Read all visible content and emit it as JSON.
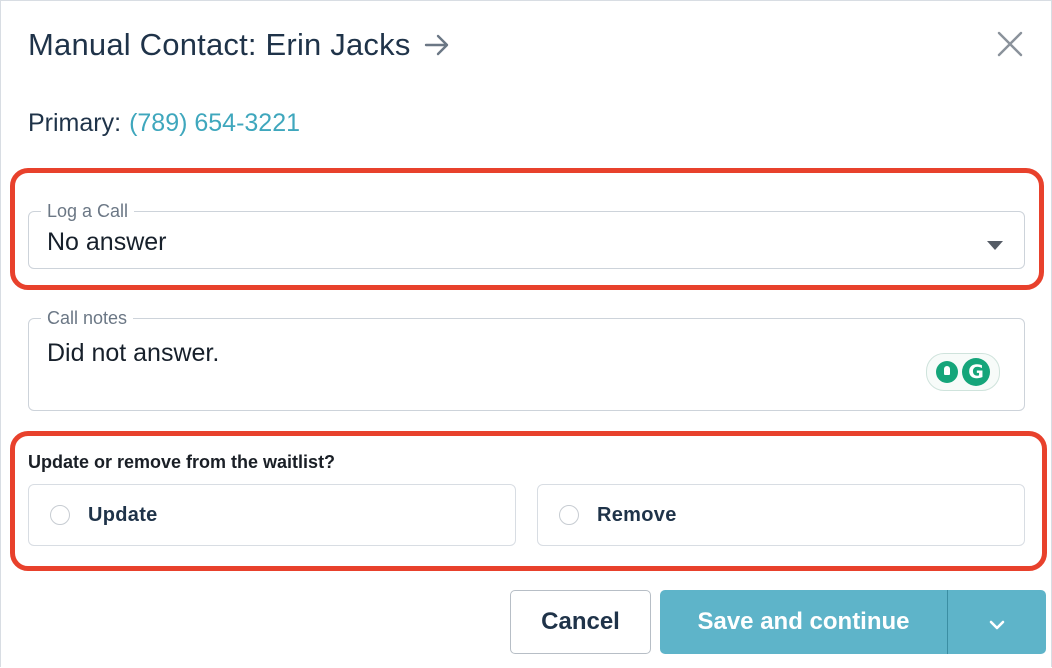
{
  "header": {
    "title": "Manual Contact: Erin Jacks",
    "arrow_icon": "arrow-right-icon",
    "close_icon": "close-icon"
  },
  "primary": {
    "label": "Primary:",
    "phone": "(789) 654-3221"
  },
  "log_call": {
    "label": "Log a Call",
    "value": "No answer"
  },
  "call_notes": {
    "label": "Call notes",
    "value": "Did not answer."
  },
  "waitlist": {
    "question": "Update or remove from the waitlist?",
    "options": [
      {
        "label": "Update",
        "selected": false
      },
      {
        "label": "Remove",
        "selected": false
      }
    ]
  },
  "footer": {
    "cancel_label": "Cancel",
    "save_label": "Save and continue"
  },
  "colors": {
    "accent": "#5eb4c9",
    "link": "#3fa7bd",
    "highlight": "#e8412c",
    "title": "#1f3349"
  }
}
